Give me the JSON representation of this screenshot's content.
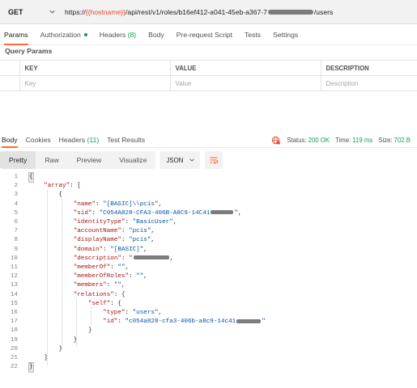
{
  "request": {
    "method": "GET",
    "url_prefix": "https://",
    "url_variable": "{{hostname}}",
    "url_path": "/api/rest/v1/roles/b16ef412-a041-45eb-a367-7",
    "url_suffix": "/users"
  },
  "request_tabs": [
    {
      "label": "Params"
    },
    {
      "label": "Authorization"
    },
    {
      "label": "Headers",
      "count": "(8)"
    },
    {
      "label": "Body"
    },
    {
      "label": "Pre-request Script"
    },
    {
      "label": "Tests"
    },
    {
      "label": "Settings"
    }
  ],
  "query_params": {
    "section_title": "Query Params",
    "headers": [
      "KEY",
      "VALUE",
      "DESCRIPTION"
    ],
    "placeholder_row": [
      "Key",
      "Value",
      "Description"
    ]
  },
  "response_tabs": [
    {
      "label": "Body"
    },
    {
      "label": "Cookies"
    },
    {
      "label": "Headers",
      "count": "(11)"
    },
    {
      "label": "Test Results"
    }
  ],
  "response_status": {
    "status_label": "Status:",
    "status_value": "200 OK",
    "time_label": "Time:",
    "time_value": "119 ms",
    "size_label": "Size:",
    "size_value": "702 B"
  },
  "view_modes": [
    "Pretty",
    "Raw",
    "Preview",
    "Visualize"
  ],
  "format_select": "JSON",
  "code_lines": [
    {
      "n": "1"
    },
    {
      "n": "2"
    },
    {
      "n": "3"
    },
    {
      "n": "4"
    },
    {
      "n": "5"
    },
    {
      "n": "6"
    },
    {
      "n": "7"
    },
    {
      "n": "8"
    },
    {
      "n": "9"
    },
    {
      "n": "10"
    },
    {
      "n": "11"
    },
    {
      "n": "12"
    },
    {
      "n": "13"
    },
    {
      "n": "14"
    },
    {
      "n": "15"
    },
    {
      "n": "16"
    },
    {
      "n": "17"
    },
    {
      "n": "18"
    },
    {
      "n": "19"
    },
    {
      "n": "20"
    },
    {
      "n": "21"
    },
    {
      "n": "22"
    }
  ],
  "json_body": {
    "key_array": "\"array\"",
    "key_name": "\"name\"",
    "val_name": "\"[BASIC]\\\\pcis\"",
    "key_sid": "\"sid\"",
    "val_sid": "\"C054A828-CFA3-406B-A8C9-14C41",
    "key_identity": "\"identityType\"",
    "val_identity": "\"BasicUser\"",
    "key_account": "\"accountName\"",
    "val_account": "\"pcis\"",
    "key_display": "\"displayName\"",
    "val_display": "\"pcis\"",
    "key_domain": "\"domain\"",
    "val_domain": "\"[BASIC]\"",
    "key_description": "\"description\"",
    "val_description": "\"",
    "key_memberof": "\"memberOf\"",
    "val_memberof": "\"\"",
    "key_memberofroles": "\"memberOfRoles\"",
    "val_memberofroles": "\"\"",
    "key_members": "\"members\"",
    "val_members": "\"\"",
    "key_relations": "\"relations\"",
    "key_self": "\"self\"",
    "key_type": "\"type\"",
    "val_type": "\"users\"",
    "key_id": "\"id\"",
    "val_id": "\"c054a828-cfa3-406b-a8c9-14c41"
  },
  "colors": {
    "accent": "#ff6c37",
    "status_ok": "#0f9d58",
    "json_key": "#a31515",
    "json_string": "#0451a5",
    "url_variable": "#e8462c"
  },
  "icons": [
    "chevron-down-icon",
    "globe-error-icon",
    "wrap-lines-icon"
  ]
}
